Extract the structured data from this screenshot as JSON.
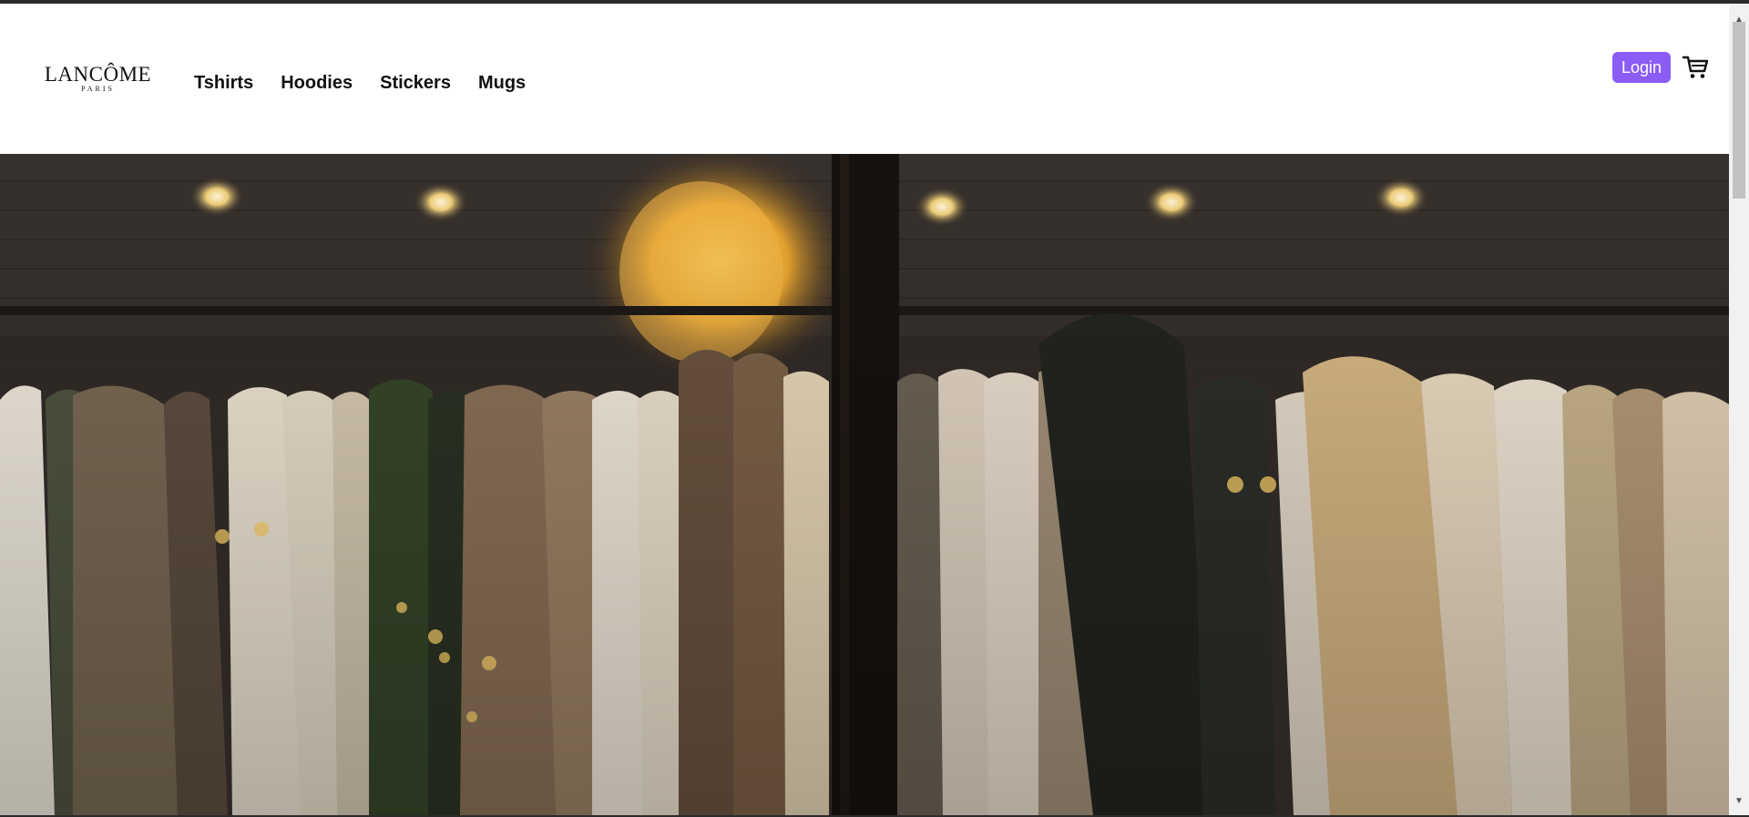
{
  "brand": {
    "name": "LANCÔME",
    "tagline": "PARIS"
  },
  "nav": {
    "items": [
      {
        "label": "Tshirts"
      },
      {
        "label": "Hoodies"
      },
      {
        "label": "Stickers"
      },
      {
        "label": "Mugs"
      }
    ]
  },
  "header": {
    "login_label": "Login",
    "cart_icon": "shopping-cart-icon"
  },
  "hero": {
    "image": "clothing-rack-photo"
  },
  "colors": {
    "accent": "#8b5cf6",
    "text": "#111111",
    "background": "#ffffff"
  }
}
